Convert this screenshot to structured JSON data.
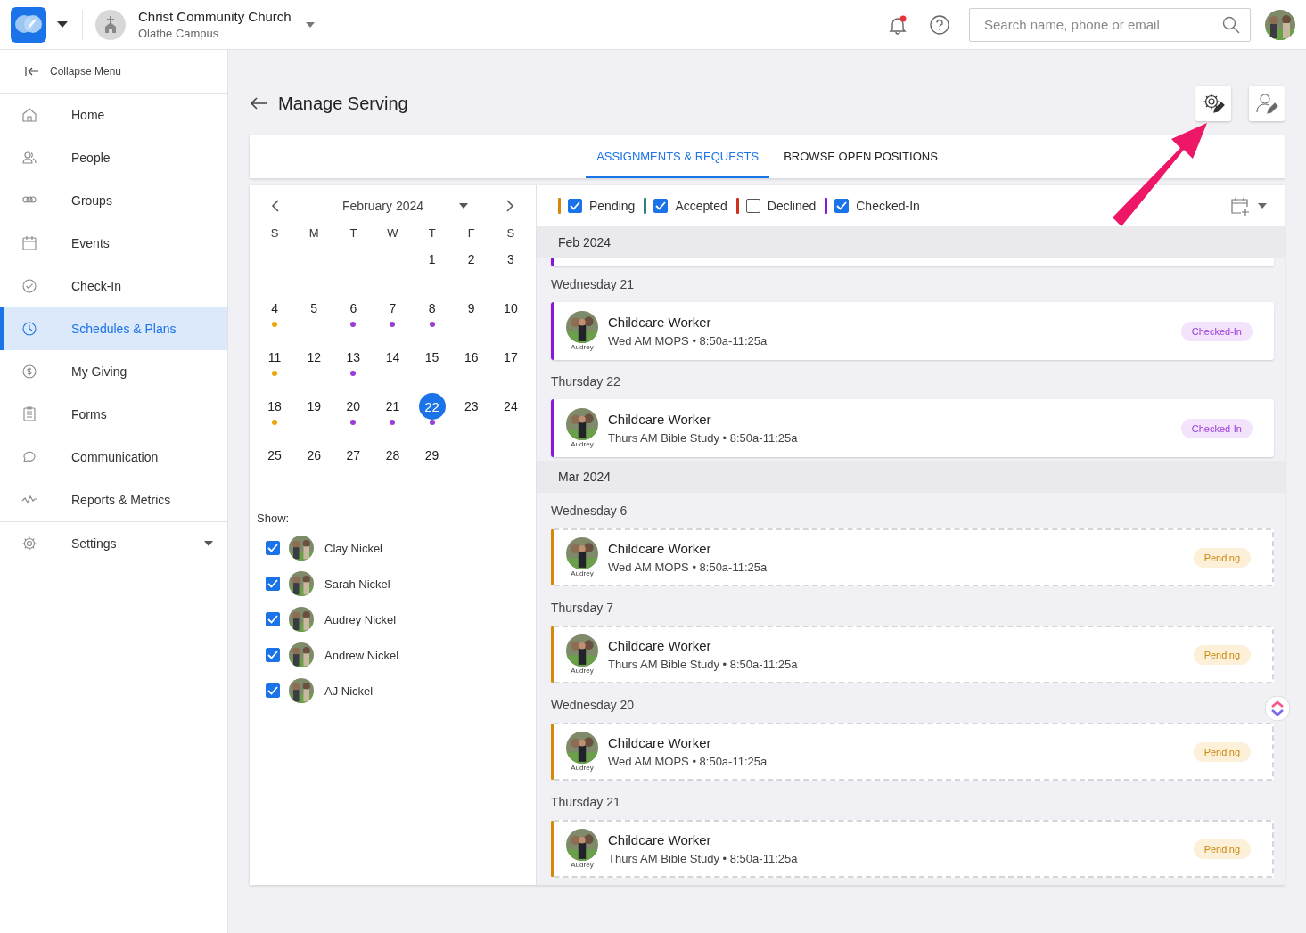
{
  "header": {
    "org_name": "Christ Community Church",
    "campus": "Olathe Campus",
    "search": {
      "placeholder": "Search name, phone or email"
    },
    "notification_unread": true
  },
  "sidebar": {
    "collapse_label": "Collapse Menu",
    "items": [
      {
        "label": "Home",
        "selected": false
      },
      {
        "label": "People",
        "selected": false
      },
      {
        "label": "Groups",
        "selected": false
      },
      {
        "label": "Events",
        "selected": false
      },
      {
        "label": "Check-In",
        "selected": false
      },
      {
        "label": "Schedules & Plans",
        "selected": true
      },
      {
        "label": "My Giving",
        "selected": false
      },
      {
        "label": "Forms",
        "selected": false
      },
      {
        "label": "Communication",
        "selected": false
      },
      {
        "label": "Reports & Metrics",
        "selected": false
      }
    ],
    "settings_label": "Settings"
  },
  "page": {
    "title": "Manage Serving"
  },
  "tabs": [
    {
      "label": "ASSIGNMENTS & REQUESTS",
      "selected": true
    },
    {
      "label": "BROWSE OPEN POSITIONS",
      "selected": false
    }
  ],
  "calendar": {
    "month": "February 2024",
    "weekdays": [
      "S",
      "M",
      "T",
      "W",
      "T",
      "F",
      "S"
    ],
    "weeks": [
      [
        {
          "day": "1",
          "selected": false
        },
        {
          "day": "2",
          "selected": false
        },
        {
          "day": "3",
          "selected": false
        }
      ],
      [
        {
          "day": "4",
          "selected": false,
          "color": "#f0a30a"
        },
        {
          "day": "5",
          "selected": false
        },
        {
          "day": "6",
          "selected": false,
          "color": "#9b3ddb"
        },
        {
          "day": "7",
          "selected": false,
          "color": "#9b3ddb"
        },
        {
          "day": "8",
          "selected": false,
          "color": "#9b3ddb"
        },
        {
          "day": "9",
          "selected": false
        },
        {
          "day": "10",
          "selected": false
        }
      ],
      [
        {
          "day": "11",
          "selected": false,
          "color": "#f0a30a"
        },
        {
          "day": "12",
          "selected": false
        },
        {
          "day": "13",
          "selected": false,
          "color": "#9b3ddb"
        },
        {
          "day": "14",
          "selected": false
        },
        {
          "day": "15",
          "selected": false
        },
        {
          "day": "16",
          "selected": false
        },
        {
          "day": "17",
          "selected": false
        }
      ],
      [
        {
          "day": "18",
          "selected": false,
          "color": "#f0a30a"
        },
        {
          "day": "19",
          "selected": false
        },
        {
          "day": "20",
          "selected": false,
          "color": "#9b3ddb"
        },
        {
          "day": "21",
          "selected": false,
          "color": "#9b3ddb"
        },
        {
          "day": "22",
          "selected": true,
          "color": "#9b3ddb"
        },
        {
          "day": "23",
          "selected": false
        },
        {
          "day": "24",
          "selected": false
        }
      ],
      [
        {
          "day": "25",
          "selected": false
        },
        {
          "day": "26",
          "selected": false
        },
        {
          "day": "27",
          "selected": false
        },
        {
          "day": "28",
          "selected": false
        },
        {
          "day": "29",
          "selected": false
        }
      ]
    ]
  },
  "show": {
    "label": "Show:",
    "people": [
      {
        "name": "Clay Nickel",
        "checked": true
      },
      {
        "name": "Sarah Nickel",
        "checked": true
      },
      {
        "name": "Audrey Nickel",
        "checked": true
      },
      {
        "name": "Andrew Nickel",
        "checked": true
      },
      {
        "name": "AJ Nickel",
        "checked": true
      }
    ]
  },
  "filters": [
    {
      "label": "Pending",
      "checked": true,
      "color": "#d4890a"
    },
    {
      "label": "Accepted",
      "checked": true,
      "color": "#2f7f7a"
    },
    {
      "label": "Declined",
      "checked": false,
      "color": "#d0321e"
    },
    {
      "label": "Checked-In",
      "checked": true,
      "color": "#8a16d6"
    }
  ],
  "months": [
    {
      "label": "Feb 2024",
      "clipped_card": true,
      "days": [
        {
          "label": "Wednesday 21",
          "cards": [
            {
              "title": "Childcare Worker",
              "detail": "Wed AM MOPS • 8:50a-11:25a",
              "person": "Audrey",
              "status": "Checked-In",
              "kind": "checked-in"
            }
          ]
        },
        {
          "label": "Thursday 22",
          "cards": [
            {
              "title": "Childcare Worker",
              "detail": "Thurs AM Bible Study • 8:50a-11:25a",
              "person": "Audrey",
              "status": "Checked-In",
              "kind": "checked-in"
            }
          ]
        }
      ]
    },
    {
      "label": "Mar 2024",
      "clipped_card": false,
      "days": [
        {
          "label": "Wednesday 6",
          "cards": [
            {
              "title": "Childcare Worker",
              "detail": "Wed AM MOPS • 8:50a-11:25a",
              "person": "Audrey",
              "status": "Pending",
              "kind": "pending"
            }
          ]
        },
        {
          "label": "Thursday 7",
          "cards": [
            {
              "title": "Childcare Worker",
              "detail": "Thurs AM Bible Study • 8:50a-11:25a",
              "person": "Audrey",
              "status": "Pending",
              "kind": "pending"
            }
          ]
        },
        {
          "label": "Wednesday 20",
          "cards": [
            {
              "title": "Childcare Worker",
              "detail": "Wed AM MOPS • 8:50a-11:25a",
              "person": "Audrey",
              "status": "Pending",
              "kind": "pending"
            }
          ]
        },
        {
          "label": "Thursday 21",
          "cards": [
            {
              "title": "Childcare Worker",
              "detail": "Thurs AM Bible Study • 8:50a-11:25a",
              "person": "Audrey",
              "status": "Pending",
              "kind": "pending"
            }
          ]
        }
      ]
    }
  ]
}
